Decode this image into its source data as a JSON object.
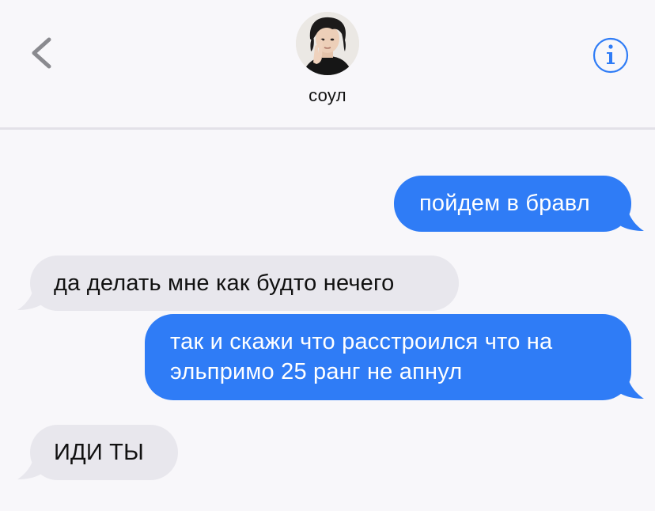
{
  "header": {
    "back_icon": "chevron-left-icon",
    "info_icon": "info-circle-icon",
    "contact_name": "соул"
  },
  "messages": [
    {
      "direction": "outgoing",
      "text": "пойдем в бравл"
    },
    {
      "direction": "incoming",
      "text": "да делать мне как будто нечего"
    },
    {
      "direction": "outgoing",
      "lines": [
        "так и скажи что расстроился что на",
        "эльпримо 25 ранг не апнул"
      ]
    },
    {
      "direction": "incoming",
      "text": "ИДИ ТЫ"
    }
  ],
  "colors": {
    "outgoing_bubble": "#2f7cf6",
    "incoming_bubble": "#e8e7ed",
    "accent": "#2f7cf6",
    "background": "#f8f7fa"
  }
}
